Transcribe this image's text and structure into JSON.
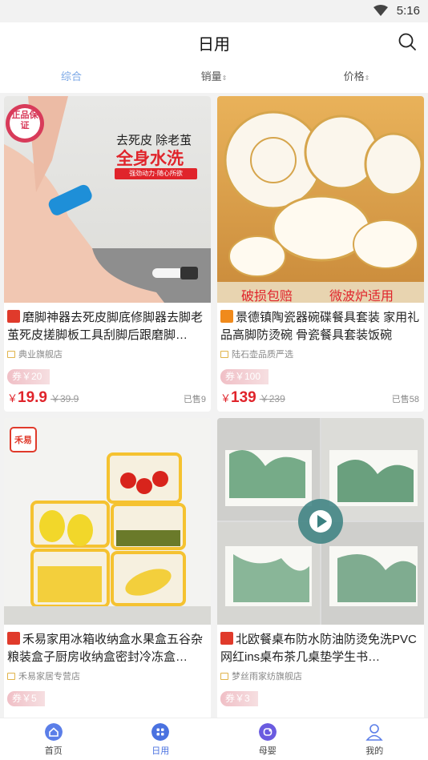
{
  "status": {
    "time": "5:16"
  },
  "header": {
    "title": "日用"
  },
  "sort_tabs": [
    {
      "label": "综合",
      "active": true
    },
    {
      "label": "销量",
      "arrows": "⇕"
    },
    {
      "label": "价格",
      "arrows": "⇕"
    }
  ],
  "products": [
    {
      "tag_color": "#e03a2b",
      "name": "磨脚神器去死皮脚底修脚器去脚老茧死皮搓脚板工具刮脚后跟磨脚…",
      "shop": "典业旗舰店",
      "coupon": "券￥20",
      "price_symbol": "￥",
      "price": "19.9",
      "orig_price": "￥39.9",
      "sold": "已售9",
      "img_text": [
        "去死皮 除老茧",
        "全身水洗",
        "强劲动力·随心所欲",
        "正品保证"
      ]
    },
    {
      "tag_color": "#f08a1c",
      "name": "景德镇陶瓷器碗碟餐具套装 家用礼品高脚防烫碗 骨瓷餐具套装饭碗",
      "shop": "陆石壶品质严选",
      "coupon": "券￥100",
      "price_symbol": "￥",
      "price": "139",
      "orig_price": "￥239",
      "sold": "已售58",
      "img_text": [
        "破损包赔",
        "微波炉适用"
      ]
    },
    {
      "tag_color": "#e03a2b",
      "name": "禾易家用冰箱收纳盒水果盒五谷杂粮装盒子厨房收纳盒密封冷冻盒…",
      "shop": "禾易家居专营店",
      "coupon": "券￥5",
      "price_symbol": "￥",
      "price": "",
      "orig_price": "",
      "sold": "",
      "img_text": [
        "禾易"
      ]
    },
    {
      "tag_color": "#e03a2b",
      "name": "北欧餐桌布防水防油防烫免洗PVC网红ins桌布茶几桌垫学生书…",
      "shop": "梦丝雨家纺旗舰店",
      "coupon": "券￥3",
      "price_symbol": "",
      "price": "",
      "orig_price": "",
      "sold": "",
      "img_text": []
    }
  ],
  "tabbar": [
    {
      "label": "首页",
      "icon": "home-icon",
      "color": "#5b7ee8"
    },
    {
      "label": "日用",
      "icon": "grid-icon",
      "color": "#4a72e0",
      "active": true
    },
    {
      "label": "母婴",
      "icon": "baby-icon",
      "color": "#6a5be0"
    },
    {
      "label": "我的",
      "icon": "user-icon",
      "color": "#5b7ee8"
    }
  ]
}
